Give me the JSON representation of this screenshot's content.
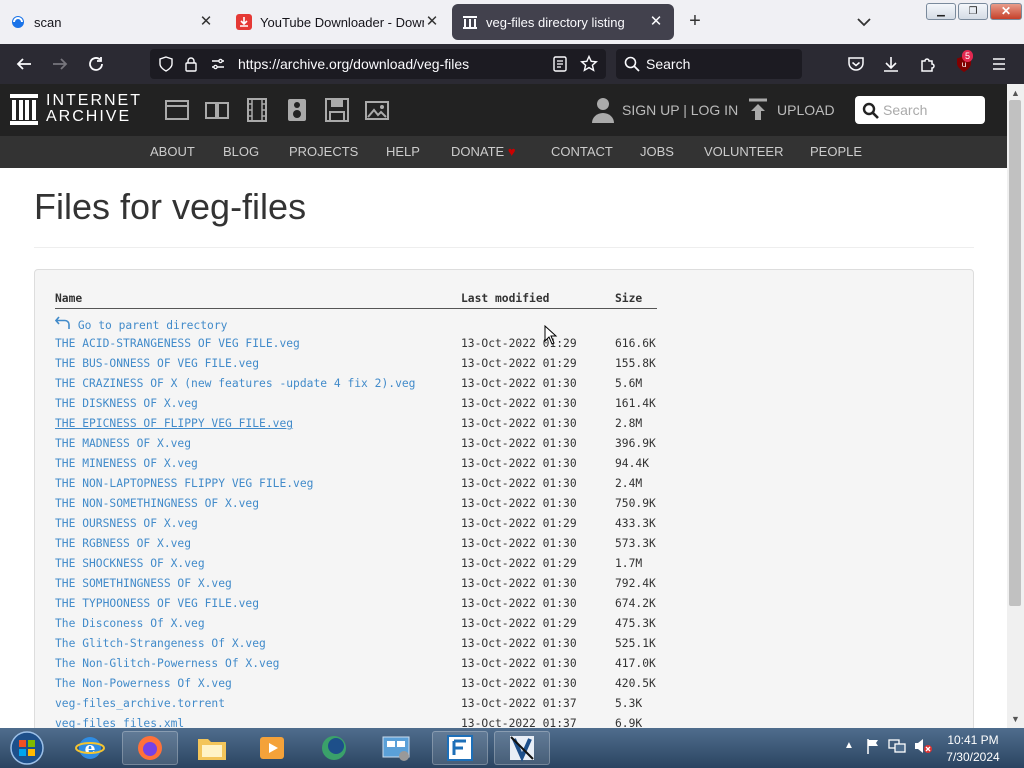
{
  "browser": {
    "tabs": [
      {
        "label": "scan",
        "active": false
      },
      {
        "label": "YouTube Downloader - Downlo",
        "active": false
      },
      {
        "label": "veg-files directory listing",
        "active": true
      }
    ],
    "url": "https://archive.org/download/veg-files",
    "search_placeholder": "Search",
    "extension_badge": "5"
  },
  "site": {
    "logo_line1": "INTERNET",
    "logo_line2": "ARCHIVE",
    "signup_login": "SIGN UP | LOG IN",
    "upload": "UPLOAD",
    "search_placeholder": "Search",
    "nav": [
      "ABOUT",
      "BLOG",
      "PROJECTS",
      "HELP",
      "DONATE",
      "CONTACT",
      "JOBS",
      "VOLUNTEER",
      "PEOPLE"
    ],
    "accent": "#cc0000"
  },
  "page": {
    "title": "Files for veg-files",
    "columns": {
      "name": "Name",
      "modified": "Last modified",
      "size": "Size"
    },
    "parent_link": "Go to parent directory",
    "files": [
      {
        "name": "THE ACID-STRANGENESS OF VEG FILE.veg",
        "modified": "13-Oct-2022 01:29",
        "size": "616.6K"
      },
      {
        "name": "THE BUS-ONNESS OF VEG FILE.veg",
        "modified": "13-Oct-2022 01:29",
        "size": "155.8K"
      },
      {
        "name": "THE CRAZINESS OF X (new features -update 4 fix 2).veg",
        "modified": "13-Oct-2022 01:30",
        "size": "5.6M"
      },
      {
        "name": "THE DISKNESS OF X.veg",
        "modified": "13-Oct-2022 01:30",
        "size": "161.4K"
      },
      {
        "name": "THE EPICNESS OF FLIPPY VEG FILE.veg",
        "modified": "13-Oct-2022 01:30",
        "size": "2.8M"
      },
      {
        "name": "THE MADNESS OF X.veg",
        "modified": "13-Oct-2022 01:30",
        "size": "396.9K"
      },
      {
        "name": "THE MINENESS OF X.veg",
        "modified": "13-Oct-2022 01:30",
        "size": "94.4K"
      },
      {
        "name": "THE NON-LAPTOPNESS FLIPPY VEG FILE.veg",
        "modified": "13-Oct-2022 01:30",
        "size": "2.4M"
      },
      {
        "name": "THE NON-SOMETHINGNESS OF X.veg",
        "modified": "13-Oct-2022 01:30",
        "size": "750.9K"
      },
      {
        "name": "THE OURSNESS OF X.veg",
        "modified": "13-Oct-2022 01:29",
        "size": "433.3K"
      },
      {
        "name": "THE RGBNESS OF X.veg",
        "modified": "13-Oct-2022 01:30",
        "size": "573.3K"
      },
      {
        "name": "THE SHOCKNESS OF X.veg",
        "modified": "13-Oct-2022 01:29",
        "size": "1.7M"
      },
      {
        "name": "THE SOMETHINGNESS OF X.veg",
        "modified": "13-Oct-2022 01:30",
        "size": "792.4K"
      },
      {
        "name": "THE TYPHOONESS OF VEG FILE.veg",
        "modified": "13-Oct-2022 01:30",
        "size": "674.2K"
      },
      {
        "name": "The Disconess Of X.veg",
        "modified": "13-Oct-2022 01:29",
        "size": "475.3K"
      },
      {
        "name": "The Glitch-Strangeness Of X.veg",
        "modified": "13-Oct-2022 01:30",
        "size": "525.1K"
      },
      {
        "name": "The Non-Glitch-Powerness Of X.veg",
        "modified": "13-Oct-2022 01:30",
        "size": "417.0K"
      },
      {
        "name": "The Non-Powerness Of X.veg",
        "modified": "13-Oct-2022 01:30",
        "size": "420.5K"
      },
      {
        "name": "veg-files_archive.torrent",
        "modified": "13-Oct-2022 01:37",
        "size": "5.3K"
      },
      {
        "name": "veg-files_files.xml",
        "modified": "13-Oct-2022 01:37",
        "size": "6.9K"
      }
    ]
  },
  "taskbar": {
    "time": "10:41 PM",
    "date": "7/30/2024"
  }
}
